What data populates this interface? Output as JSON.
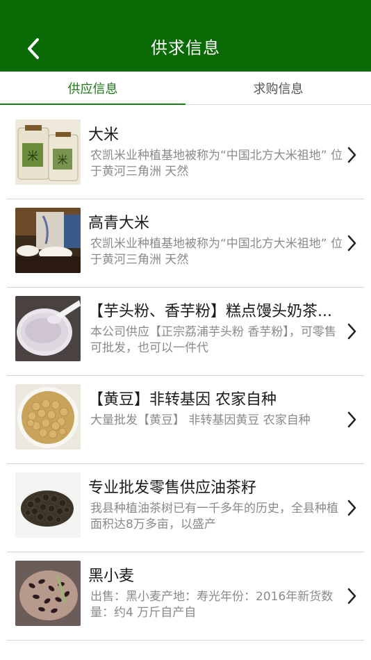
{
  "header": {
    "title": "供求信息",
    "back_icon": "chevron-left-icon",
    "bar_color": "#0a6a06"
  },
  "tabs": [
    {
      "label": "供应信息",
      "active": true
    },
    {
      "label": "求购信息",
      "active": false
    }
  ],
  "accent_color": "#1d7a17",
  "items": [
    {
      "title": "大米",
      "desc": "农凯米业种植基地被称为“中国北方大米祖地” 位于黄河三角洲 天然",
      "thumb": "rice-bags"
    },
    {
      "title": "高青大米",
      "desc": "农凯米业种植基地被称为“中国北方大米祖地” 位于黄河三角洲 天然",
      "thumb": "rice-bowl"
    },
    {
      "title": "【芋头粉、香芋粉】糕点馒头奶茶...",
      "desc": "本公司供应【正宗荔浦芋头粉 香芋粉】，可零售可批发，也可以一件代",
      "thumb": "taro-powder"
    },
    {
      "title": "【黄豆】非转基因 农家自种",
      "desc": "大量批发【黄豆】 非转基因黄豆 农家自种",
      "thumb": "soybeans"
    },
    {
      "title": "专业批发零售供应油茶籽",
      "desc": "我县种植油茶树已有一千多年的历史，全县种植面积达8万多亩，以盛产",
      "thumb": "camellia-seeds"
    },
    {
      "title": "黑小麦",
      "desc": "出售：黑小麦产地：寿光年份：2016年新货数量：约4 万斤自产自",
      "thumb": "black-wheat"
    }
  ]
}
